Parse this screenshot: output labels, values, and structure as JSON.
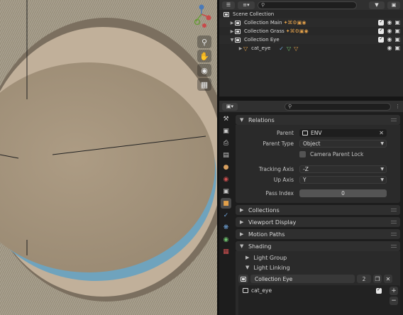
{
  "outliner": {
    "search_placeholder": "",
    "rows": [
      {
        "label": "Scene Collection"
      },
      {
        "label": "Collection Main",
        "icons": "✦⌘⚙▣◉"
      },
      {
        "label": "Collection Grass",
        "icons": "✦⌘⚙▣◉"
      },
      {
        "label": "Collection Eye"
      },
      {
        "label": "cat_eye"
      }
    ]
  },
  "properties": {
    "search_placeholder": "",
    "sections": {
      "relations": "Relations",
      "collections": "Collections",
      "viewport_display": "Viewport Display",
      "motion_paths": "Motion Paths",
      "shading": "Shading",
      "light_group": "Light Group",
      "light_linking": "Light Linking"
    },
    "relations": {
      "parent_label": "Parent",
      "parent_value": "ENV",
      "parent_type_label": "Parent Type",
      "parent_type_value": "Object",
      "camera_parent_lock": "Camera Parent Lock",
      "tracking_axis_label": "Tracking Axis",
      "tracking_axis_value": "-Z",
      "up_axis_label": "Up Axis",
      "up_axis_value": "Y",
      "pass_index_label": "Pass Index",
      "pass_index_value": "0"
    },
    "light_linking": {
      "collection_name": "Collection Eye",
      "user_count": "2",
      "items": [
        "cat_eye"
      ]
    }
  },
  "colors": {
    "accent_orange": "#e2a04a",
    "viewport_cornea": "#a89680",
    "viewport_rim": "#6fa3bd"
  }
}
